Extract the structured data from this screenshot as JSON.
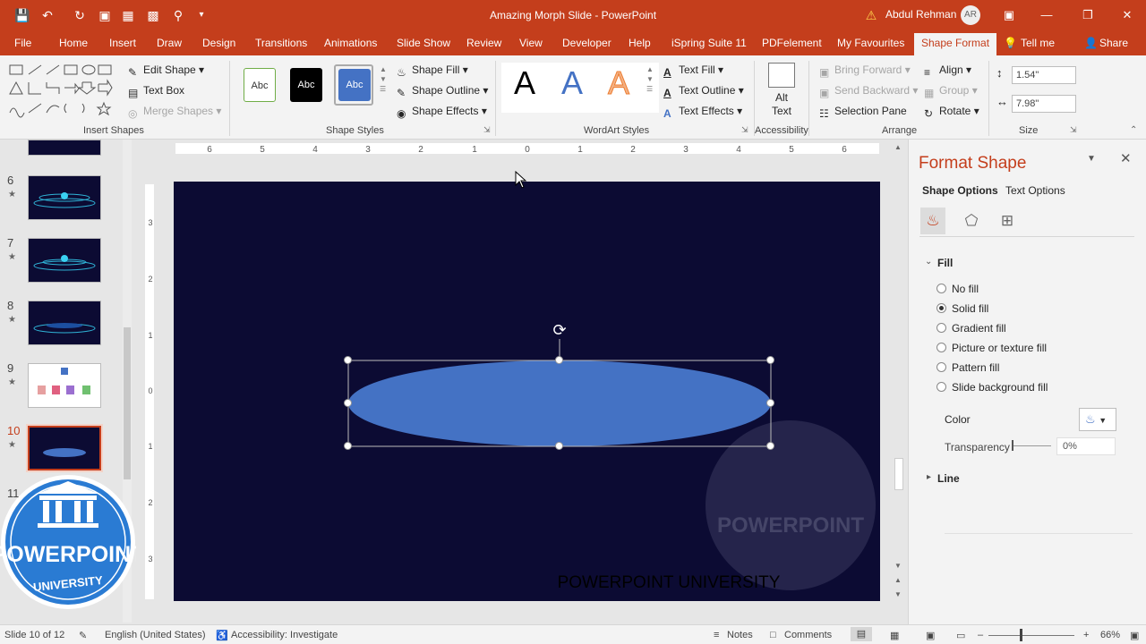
{
  "app": {
    "title": "Amazing Morph Slide  -  PowerPoint",
    "user_name": "Abdul Rehman",
    "user_initials": "AR"
  },
  "menu": {
    "tabs": [
      "File",
      "Home",
      "Insert",
      "Draw",
      "Design",
      "Transitions",
      "Animations",
      "Slide Show",
      "Review",
      "View",
      "Developer",
      "Help",
      "iSpring Suite 11",
      "PDFelement",
      "My Favourites",
      "Shape Format"
    ],
    "tell_me": "Tell me",
    "share": "Share"
  },
  "ribbon": {
    "insert_shapes": {
      "label": "Insert Shapes",
      "edit_shape": "Edit Shape",
      "text_box": "Text Box",
      "merge_shapes": "Merge Shapes"
    },
    "shape_styles": {
      "label": "Shape Styles",
      "samples": [
        "Abc",
        "Abc",
        "Abc"
      ],
      "shape_fill": "Shape Fill",
      "shape_outline": "Shape Outline",
      "shape_effects": "Shape Effects"
    },
    "wordart": {
      "label": "WordArt Styles",
      "samples": [
        "A",
        "A",
        "A"
      ],
      "text_fill": "Text Fill",
      "text_outline": "Text Outline",
      "text_effects": "Text Effects"
    },
    "accessibility": {
      "label": "Accessibility",
      "alt_text": "Alt Text"
    },
    "arrange": {
      "label": "Arrange",
      "bring_forward": "Bring Forward",
      "send_backward": "Send Backward",
      "selection_pane": "Selection Pane",
      "align": "Align",
      "group": "Group",
      "rotate": "Rotate"
    },
    "size": {
      "label": "Size",
      "height": "1.54\"",
      "width": "7.98\""
    }
  },
  "thumbnails": {
    "numbers": [
      "6",
      "7",
      "8",
      "9",
      "10",
      "11"
    ],
    "star": "★",
    "active": "10"
  },
  "ruler": {
    "h_ticks": [
      "6",
      "5",
      "4",
      "3",
      "2",
      "1",
      "0",
      "1",
      "2",
      "3",
      "4",
      "5",
      "6"
    ],
    "v_ticks": [
      "3",
      "2",
      "1",
      "0",
      "1",
      "2",
      "3"
    ]
  },
  "slide": {
    "watermark_text": "POWERPOINT UNIVERSITY",
    "logo_top": "POWERPOINT",
    "logo_bottom": "UNIVERSITY"
  },
  "format_pane": {
    "title": "Format Shape",
    "tab_shape": "Shape Options",
    "tab_text": "Text Options",
    "fill_heading": "Fill",
    "fill_options": [
      "No fill",
      "Solid fill",
      "Gradient fill",
      "Picture or texture fill",
      "Pattern fill",
      "Slide background fill"
    ],
    "selected_fill": "Solid fill",
    "color_label": "Color",
    "transparency_label": "Transparency",
    "transparency_value": "0%",
    "line_heading": "Line"
  },
  "status": {
    "slide_info": "Slide 10 of 12",
    "language": "English (United States)",
    "accessibility": "Accessibility: Investigate",
    "notes": "Notes",
    "comments": "Comments",
    "zoom": "66%"
  },
  "colors": {
    "accent": "#c43e1c",
    "slide_bg": "#0c0b33",
    "shape_fill": "#4472c4"
  }
}
